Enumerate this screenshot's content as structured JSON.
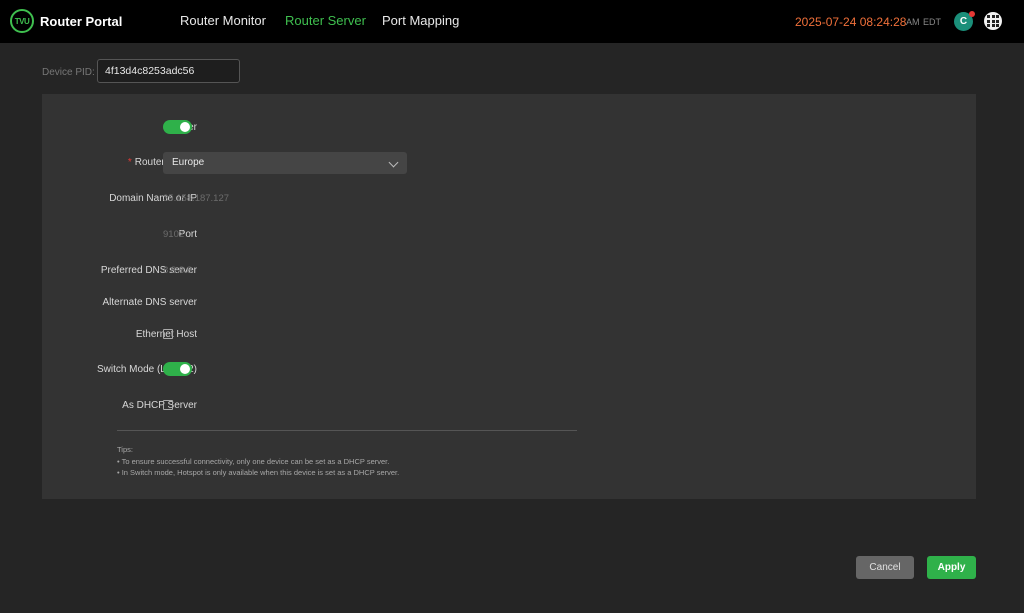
{
  "header": {
    "logo_text": "TVU",
    "app_title": "Router Portal",
    "nav": [
      "Router Monitor",
      "Router Server",
      "Port Mapping"
    ],
    "active_nav": "Router Server",
    "datetime": "2025-07-24 08:24:28",
    "ampm": "AM",
    "timezone": "EDT",
    "avatar_initial": "C"
  },
  "device": {
    "pid_label": "Device PID:",
    "pid_value": "4f13d4c8253adc56"
  },
  "form": {
    "router_label": "Router",
    "router_enabled": true,
    "router_server_label": "Router Server",
    "router_server_required": "*",
    "router_server_value": "Europe",
    "domain_label": "Domain Name or IP",
    "domain_value": "35.158.187.127",
    "port_label": "Port",
    "port_value": "9102",
    "preferred_dns_label": "Preferred DNS server",
    "preferred_dns_value": "8.8.8.8",
    "alternate_dns_label": "Alternate DNS server",
    "alternate_dns_value": "",
    "ethernet_host_label": "Ethernet Host",
    "ethernet_host_checked": false,
    "switch_mode_label": "Switch Mode (Layer 2)",
    "switch_mode_enabled": true,
    "dhcp_server_label": "As DHCP Server",
    "dhcp_server_checked": false
  },
  "tips": {
    "title": "Tips:",
    "lines": [
      "• To ensure successful connectivity, only one device can be set as a DHCP server.",
      "• In Switch mode, Hotspot is only available when this device is set as a DHCP server."
    ]
  },
  "actions": {
    "cancel": "Cancel",
    "apply": "Apply"
  },
  "colors": {
    "accent_green": "#2fb14a",
    "datetime_orange": "#f0703a",
    "required_red": "#e53935"
  }
}
